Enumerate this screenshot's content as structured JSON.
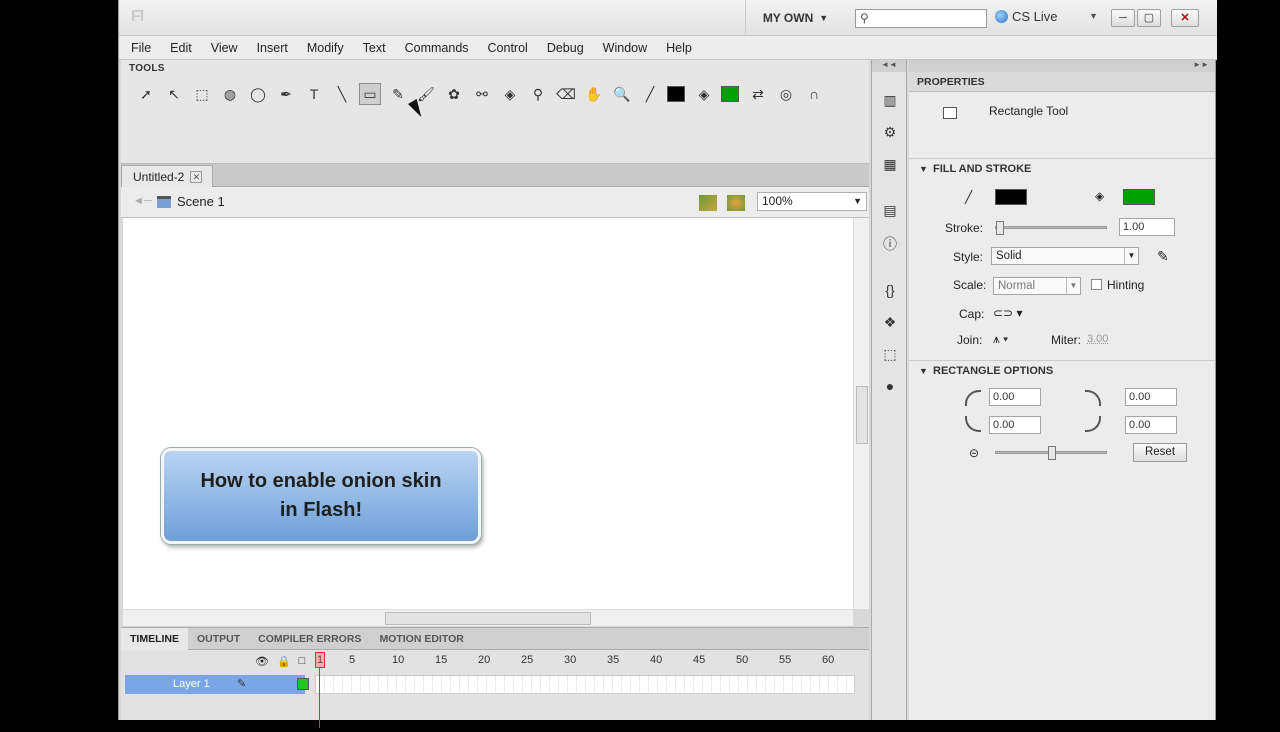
{
  "app": {
    "logo": "Fl",
    "workspace": "MY OWN",
    "search_placeholder": "",
    "cs_live": "CS Live"
  },
  "menu": [
    "File",
    "Edit",
    "View",
    "Insert",
    "Modify",
    "Text",
    "Commands",
    "Control",
    "Debug",
    "Window",
    "Help"
  ],
  "tools": {
    "title": "TOOLS",
    "items": [
      "selection-icon",
      "subselection-icon",
      "free-transform-icon",
      "3d-rotation-icon",
      "lasso-icon",
      "pen-icon",
      "text-tool-icon",
      "line-icon",
      "rectangle-icon",
      "pencil-icon",
      "brush-icon",
      "deco-icon",
      "bone-icon",
      "paint-bucket-icon",
      "eyedropper-icon",
      "eraser-icon",
      "hand-icon",
      "zoom-icon"
    ],
    "stroke_color": "#000000",
    "fill_color": "#00a000"
  },
  "document": {
    "tab": "Untitled-2",
    "scene": "Scene 1",
    "zoom": "100%"
  },
  "stage": {
    "callout_text": "How to enable onion skin in Flash!"
  },
  "timeline": {
    "tabs": [
      "TIMELINE",
      "OUTPUT",
      "COMPILER ERRORS",
      "MOTION EDITOR"
    ],
    "frame_marks": [
      "1",
      "5",
      "10",
      "15",
      "20",
      "25",
      "30",
      "35",
      "40",
      "45",
      "50",
      "55",
      "60"
    ],
    "layer_name": "Layer 1"
  },
  "properties": {
    "title": "PROPERTIES",
    "tool_name": "Rectangle Tool",
    "fill_stroke_section": "FILL AND STROKE",
    "stroke_label": "Stroke:",
    "stroke_value": "1.00",
    "style_label": "Style:",
    "style_value": "Solid",
    "scale_label": "Scale:",
    "scale_value": "Normal",
    "hinting_label": "Hinting",
    "cap_label": "Cap:",
    "join_label": "Join:",
    "miter_label": "Miter:",
    "miter_value": "3.00",
    "rect_section": "RECTANGLE OPTIONS",
    "corners": [
      "0.00",
      "0.00",
      "0.00",
      "0.00"
    ],
    "reset_label": "Reset"
  }
}
